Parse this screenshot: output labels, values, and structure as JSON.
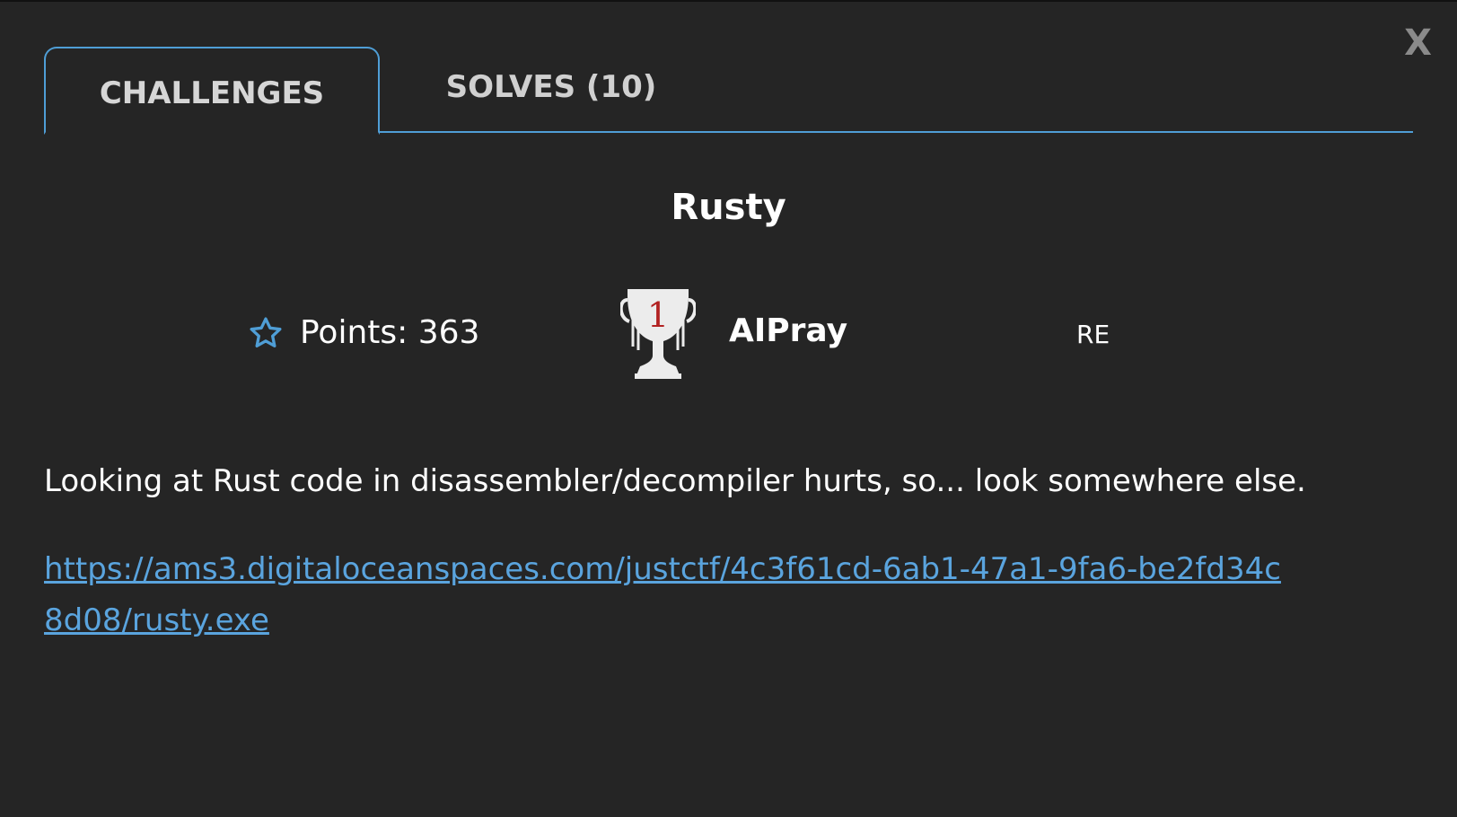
{
  "window": {
    "close_label": "X"
  },
  "tabs": [
    {
      "label": "CHALLENGES",
      "active": true
    },
    {
      "label": "SOLVES (10)",
      "active": false
    }
  ],
  "challenge": {
    "name": "Rusty",
    "points_label": "Points: 363",
    "first_blood_rank": "1",
    "first_blood_solver": "AIPray",
    "category": "RE",
    "description": "Looking at Rust code in disassembler/decompiler hurts, so... look somewhere else.",
    "file_link": "https://ams3.digitaloceanspaces.com/justctf/4c3f61cd-6ab1-47a1-9fa6-be2fd34c8d08/rusty.exe"
  },
  "icons": {
    "star": "star-outline-icon",
    "trophy": "trophy-icon"
  },
  "colors": {
    "background": "#252525",
    "accent": "#4f9ed6",
    "link": "#5aa4de",
    "trophy_number": "#b22222"
  }
}
